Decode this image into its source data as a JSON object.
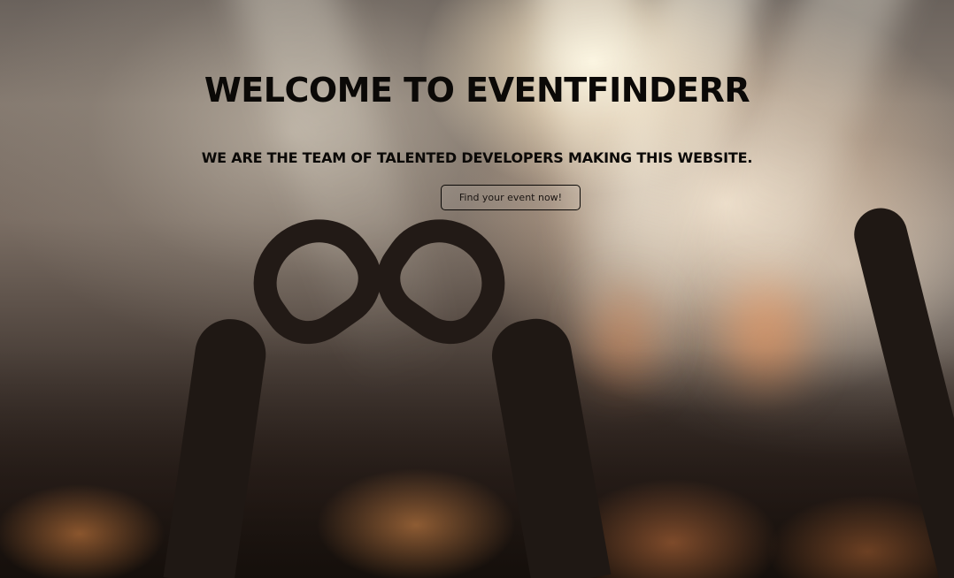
{
  "hero": {
    "title": "WELCOME TO EVENTFINDERR",
    "subtitle": "WE ARE THE TEAM OF TALENTED DEVELOPERS MAKING THIS WEBSITE.",
    "cta_label": "Find your event now!"
  },
  "background": {
    "image_subject": "concert-crowd-heart-hands",
    "text_color": "#0b0907"
  }
}
